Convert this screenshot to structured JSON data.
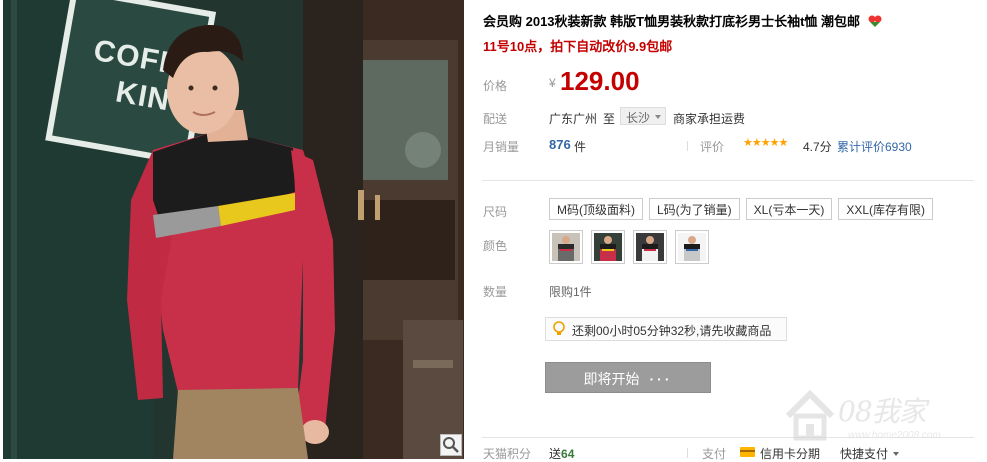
{
  "product": {
    "title": "会员购 2013秋装新款 韩版T恤男装秋款打底衫男士长袖t恤 潮包邮",
    "promo": "11号10点，拍下自动改价9.9包邮",
    "sign_text": "COFFEE KING"
  },
  "price": {
    "label": "价格",
    "currency": "¥",
    "value": "129.00"
  },
  "shipping": {
    "label": "配送",
    "from": "广东广州",
    "to_word": "至",
    "city": "长沙",
    "fee": "商家承担运费"
  },
  "sales": {
    "label": "月销量",
    "count": "876",
    "unit": "件",
    "rating_label": "评价",
    "stars": "★★★★★",
    "score": "4.7分",
    "review_count": "累计评价6930"
  },
  "size": {
    "label": "尺码",
    "options": [
      "M码(顶级面料)",
      "L码(为了销量)",
      "XL(亏本一天)",
      "XXL(库存有限)"
    ]
  },
  "color": {
    "label": "颜色"
  },
  "quantity": {
    "label": "数量",
    "limit": "限购1件"
  },
  "notice": {
    "text": "还剩00小时05分钟32秒,请先收藏商品"
  },
  "action": {
    "start_label": "即将开始",
    "dots": "···"
  },
  "footer": {
    "points_label": "天猫积分",
    "points_prefix": "送",
    "points_value": "64",
    "pay_label": "支付",
    "pay_card": "信用卡分期",
    "pay_fast": "快捷支付"
  },
  "watermark": {
    "text": "08我家",
    "url": "www.home2008.com"
  },
  "colors": {
    "price_red": "#c40000",
    "link_blue": "#3366aa",
    "star_orange": "#ffa200",
    "shirt_red": "#c8304a",
    "shirt_black": "#1c1c1c",
    "stripe_yellow": "#e8c81c",
    "stripe_gray": "#9a9a9a"
  }
}
